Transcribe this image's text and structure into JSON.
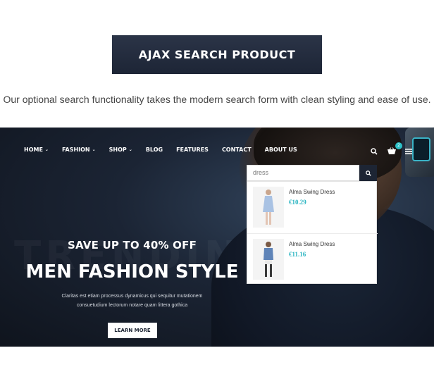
{
  "section": {
    "title": "AJAX SEARCH PRODUCT",
    "subtitle": "Our optional search functionality takes the modern search form with clean styling and ease of use."
  },
  "nav": {
    "items": [
      {
        "label": "HOME",
        "dropdown": true
      },
      {
        "label": "FASHION",
        "dropdown": true
      },
      {
        "label": "SHOP",
        "dropdown": true
      },
      {
        "label": "BLOG",
        "dropdown": false
      },
      {
        "label": "FEATURES",
        "dropdown": false
      },
      {
        "label": "CONTACT",
        "dropdown": false
      },
      {
        "label": "ABOUT US",
        "dropdown": false
      }
    ],
    "cart_count": "2"
  },
  "search": {
    "value": "dress",
    "results": [
      {
        "name": "Alma Swing Dress",
        "price": "€10.29"
      },
      {
        "name": "Alma Swing Dress",
        "price": "€11.16"
      }
    ]
  },
  "hero": {
    "ghost_text": "TRENDING",
    "offer": "SAVE UP TO 40% OFF",
    "headline": "MEN FASHION STYLE",
    "blurb_line1": "Claritas est etiam processus dynamicus qui sequitur mutationem",
    "blurb_line2": "consuetudium lectorum notare quam littera gothica",
    "cta": "LEARN MORE"
  },
  "colors": {
    "accent": "#2bb5c2",
    "dark": "#1d2534"
  }
}
